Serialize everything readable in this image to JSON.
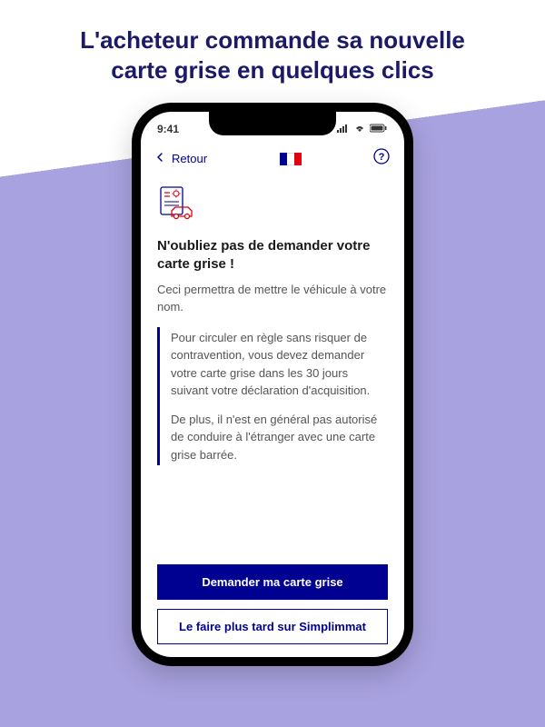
{
  "hero": {
    "title": "L'acheteur commande sa nouvelle carte grise en quelques clics"
  },
  "statusbar": {
    "time": "9:41"
  },
  "nav": {
    "back_label": "Retour"
  },
  "screen": {
    "title": "N'oubliez pas de demander votre carte grise !",
    "intro": "Ceci permettra de mettre le véhicule à votre nom.",
    "info_p1": "Pour circuler en règle sans risquer de contravention, vous devez demander votre carte grise dans les 30 jours suivant votre déclaration d'acquisition.",
    "info_p2": "De plus, il n'est en général pas autorisé de conduire à l'étranger avec une carte grise barrée."
  },
  "buttons": {
    "primary": "Demander ma carte grise",
    "secondary": "Le faire plus tard sur Simplimmat"
  }
}
